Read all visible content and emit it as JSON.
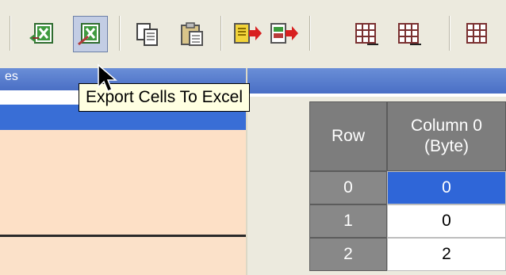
{
  "toolbar": {
    "buttons": [
      {
        "icon": "import-excel-icon"
      },
      {
        "icon": "export-cells-to-excel-icon",
        "active": true
      },
      {
        "icon": "copy-icon"
      },
      {
        "icon": "paste-icon"
      },
      {
        "icon": "move-in-icon"
      },
      {
        "icon": "move-out-icon"
      },
      {
        "icon": "insert-row-icon"
      },
      {
        "icon": "insert-column-icon"
      },
      {
        "icon": "grid-icon"
      }
    ]
  },
  "tooltip": {
    "text": "Export Cells To Excel"
  },
  "left_panel": {
    "header_text": "es"
  },
  "grid": {
    "columns": [
      {
        "label": "Row"
      },
      {
        "label": "Column 0\n(Byte)"
      }
    ],
    "rows": [
      {
        "row": "0",
        "value": "0",
        "selected": true
      },
      {
        "row": "1",
        "value": "0",
        "selected": false
      },
      {
        "row": "2",
        "value": "2",
        "selected": false
      }
    ]
  },
  "colors": {
    "toolbar_bg": "#eceade",
    "header_blue": "#4a6fc5",
    "selection_blue": "#2f66d8",
    "peach": "#fde0c6",
    "tooltip_bg": "#ffffe1"
  }
}
